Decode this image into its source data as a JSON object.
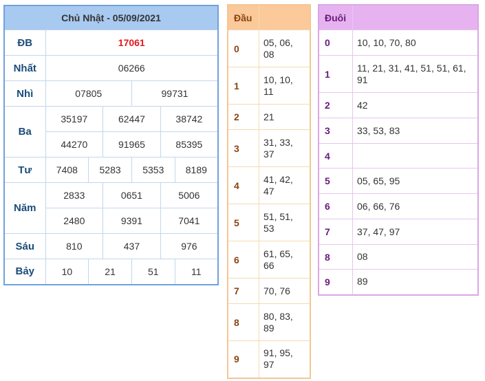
{
  "results": {
    "date_title": "Chủ Nhật - 05/09/2021",
    "rows": {
      "db": {
        "label": "ĐB",
        "values": [
          "17061"
        ]
      },
      "nhat": {
        "label": "Nhất",
        "values": [
          "06266"
        ]
      },
      "nhi": {
        "label": "Nhì",
        "values": [
          "07805",
          "99731"
        ]
      },
      "ba": {
        "label": "Ba",
        "values": [
          "35197",
          "62447",
          "38742",
          "44270",
          "91965",
          "85395"
        ]
      },
      "tu": {
        "label": "Tư",
        "values": [
          "7408",
          "5283",
          "5353",
          "8189"
        ]
      },
      "nam": {
        "label": "Năm",
        "values": [
          "2833",
          "0651",
          "5006",
          "2480",
          "9391",
          "7041"
        ]
      },
      "sau": {
        "label": "Sáu",
        "values": [
          "810",
          "437",
          "976"
        ]
      },
      "bay": {
        "label": "Bảy",
        "values": [
          "10",
          "21",
          "51",
          "11"
        ]
      }
    }
  },
  "dau": {
    "header": "Đầu",
    "rows": [
      {
        "key": "0",
        "value": "05, 06, 08"
      },
      {
        "key": "1",
        "value": "10, 10, 11"
      },
      {
        "key": "2",
        "value": "21"
      },
      {
        "key": "3",
        "value": "31, 33, 37"
      },
      {
        "key": "4",
        "value": "41, 42, 47"
      },
      {
        "key": "5",
        "value": "51, 51, 53"
      },
      {
        "key": "6",
        "value": "61, 65, 66"
      },
      {
        "key": "7",
        "value": "70, 76"
      },
      {
        "key": "8",
        "value": "80, 83, 89"
      },
      {
        "key": "9",
        "value": "91, 95, 97"
      }
    ]
  },
  "duoi": {
    "header": "Đuôi",
    "rows": [
      {
        "key": "0",
        "value": "10, 10, 70, 80"
      },
      {
        "key": "1",
        "value": "11, 21, 31, 41, 51, 51, 61, 91"
      },
      {
        "key": "2",
        "value": "42"
      },
      {
        "key": "3",
        "value": "33, 53, 83"
      },
      {
        "key": "4",
        "value": ""
      },
      {
        "key": "5",
        "value": "05, 65, 95"
      },
      {
        "key": "6",
        "value": "06, 66, 76"
      },
      {
        "key": "7",
        "value": "37, 47, 97"
      },
      {
        "key": "8",
        "value": "08"
      },
      {
        "key": "9",
        "value": "89"
      }
    ]
  }
}
